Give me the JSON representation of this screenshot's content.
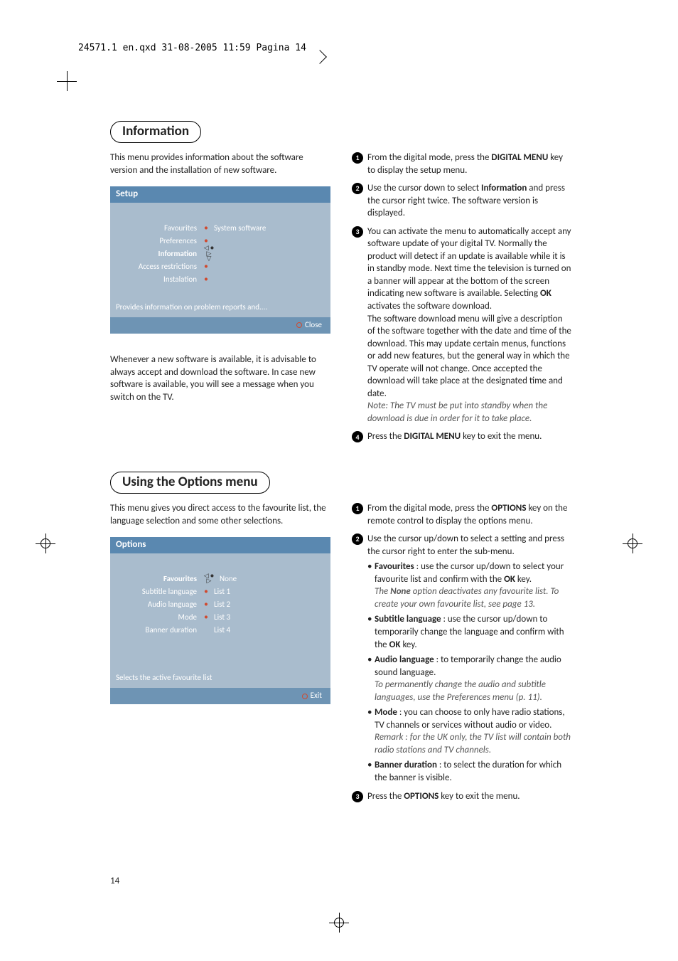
{
  "header": "24571.1 en.qxd  31-08-2005  11:59  Pagina 14",
  "section1": {
    "title": "Information",
    "intro": "This menu provides information about the software version and the installation of new software.",
    "osd": {
      "panel_title": "Setup",
      "rows": [
        {
          "label": "Favourites",
          "value": "System software",
          "bold": false,
          "nav": false
        },
        {
          "label": "Preferences",
          "value": "",
          "bold": false,
          "nav": false
        },
        {
          "label": "Information",
          "value": "",
          "bold": true,
          "nav": true
        },
        {
          "label": "Access restrictions",
          "value": "",
          "bold": false,
          "nav": false
        },
        {
          "label": "Instalation",
          "value": "",
          "bold": false,
          "nav": false
        }
      ],
      "hint": "Provides information on problem reports and....",
      "footer": "Close"
    },
    "left_note": "Whenever a new software is available, it is advisable to always accept and download the software. In case new software is available, you will see a message when you switch on the TV.",
    "steps": {
      "s1a": "From the digital mode, press the ",
      "s1b": "DIGITAL MENU",
      "s1c": " key to display the setup menu.",
      "s2a": "Use the cursor down to select ",
      "s2b": "Information",
      "s2c": " and press the cursor right twice. The software version is displayed.",
      "s3a": "You can activate the menu to automatically accept any software update of your digital TV. Normally the product will detect if an update is available while it is in standby mode. Next time the television is turned on a banner will appear at the bottom of the screen indicating new software is available. Selecting ",
      "s3b": "OK",
      "s3c": " activates the software download.",
      "s3d": "The software download menu will give a description of the software together with the date and time of the download. This may update certain menus, functions or add new features, but the general way in which the TV operate will not change. Once accepted the download will take place at the designated time and date.",
      "s3note": "Note: The TV must be put into standby when the download is due in order for it to take place.",
      "s4a": " Press the ",
      "s4b": "DIGITAL MENU",
      "s4c": " key to exit the menu."
    }
  },
  "section2": {
    "title": "Using the Options menu",
    "intro": "This menu gives you direct access to the favourite list, the language selection and some other selections.",
    "osd": {
      "panel_title": "Options",
      "rows": [
        {
          "label": "Favourites",
          "value": "None",
          "bold": true,
          "nav": true
        },
        {
          "label": "Subtitle language",
          "value": "List 1",
          "bold": false,
          "nav": false
        },
        {
          "label": "Audio language",
          "value": "List 2",
          "bold": false,
          "nav": false
        },
        {
          "label": "Mode",
          "value": "List 3",
          "bold": false,
          "nav": false
        },
        {
          "label": "Banner duration",
          "value": "List 4",
          "bold": false,
          "nav": false
        }
      ],
      "hint": "Selects the active favourite list",
      "footer": "Exit"
    },
    "steps": {
      "s1a": "From the digital mode, press the ",
      "s1b": "OPTIONS",
      "s1c": " key on the remote control to display the options menu.",
      "s2": "Use the cursor up/down to select a setting and press the cursor right to enter the sub-menu.",
      "fav_a": "Favourites",
      "fav_b": " : use the cursor up/down to select your favourite list and confirm with the ",
      "fav_c": "OK",
      "fav_d": " key.",
      "fav_note_a": "The ",
      "fav_note_b": "None",
      "fav_note_c": " option deactivates any favourite list. To create your own favourite list, see page 13.",
      "sub_a": "Subtitle language",
      "sub_b": " : use the cursor up/down to temporarily change the language and confirm with the ",
      "sub_c": "OK",
      "sub_d": " key.",
      "aud_a": "Audio language",
      "aud_b": " : to temporarily change the audio sound language.",
      "aud_note": "To permanently change the audio and subtitle languages, use the Preferences menu (p. 11).",
      "mode_a": "Mode",
      "mode_b": " : you can choose to only have radio stations, TV channels or services without audio or video.",
      "mode_note": "Remark : for the UK only, the TV list will contain both radio stations and TV channels.",
      "ban_a": "Banner duration",
      "ban_b": " : to select the duration for which the banner is visible.",
      "s3a": "Press the ",
      "s3b": "OPTIONS",
      "s3c": " key to exit the menu."
    }
  },
  "page_number": "14"
}
